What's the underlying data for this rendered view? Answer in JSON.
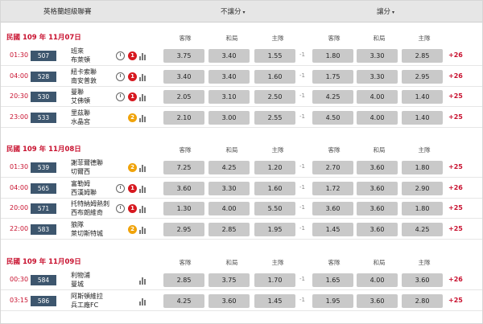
{
  "header": {
    "league": "英格蘭超級聯賽",
    "market_a": "不讓分",
    "market_b": "讓分",
    "caret": "▾"
  },
  "columns": {
    "away": "客隊",
    "draw": "和局",
    "home": "主隊"
  },
  "days": [
    {
      "date": "民國 109 年 11月07日",
      "matches": [
        {
          "time": "01:30",
          "id": "507",
          "team1": "班來",
          "team2": "布萊頓",
          "clock": true,
          "badge": "1",
          "badge_color": "red",
          "o1": "3.75",
          "o2": "3.40",
          "o3": "1.55",
          "hcap": "-1",
          "h1": "1.80",
          "h2": "3.30",
          "h3": "2.85",
          "more": "+26"
        },
        {
          "time": "04:00",
          "id": "528",
          "team1": "紐卡索聯",
          "team2": "南安普敦",
          "clock": true,
          "badge": "1",
          "badge_color": "red",
          "o1": "3.40",
          "o2": "3.40",
          "o3": "1.60",
          "hcap": "-1",
          "h1": "1.75",
          "h2": "3.30",
          "h3": "2.95",
          "more": "+26"
        },
        {
          "time": "20:30",
          "id": "530",
          "team1": "曼聯",
          "team2": "艾佛頓",
          "clock": true,
          "badge": "1",
          "badge_color": "red",
          "o1": "2.05",
          "o2": "3.10",
          "o3": "2.50",
          "hcap": "-1",
          "h1": "4.25",
          "h2": "4.00",
          "h3": "1.40",
          "more": "+25"
        },
        {
          "time": "23:00",
          "id": "533",
          "team1": "里茲聯",
          "team2": "水晶宮",
          "clock": false,
          "badge": "2",
          "badge_color": "orange",
          "o1": "2.10",
          "o2": "3.00",
          "o3": "2.55",
          "hcap": "-1",
          "h1": "4.50",
          "h2": "4.00",
          "h3": "1.40",
          "more": "+25"
        }
      ]
    },
    {
      "date": "民國 109 年 11月08日",
      "matches": [
        {
          "time": "01:30",
          "id": "539",
          "team1": "謝菲爾德聯",
          "team2": "切爾西",
          "clock": false,
          "badge": "2",
          "badge_color": "orange",
          "o1": "7.25",
          "o2": "4.25",
          "o3": "1.20",
          "hcap": "-1",
          "h1": "2.70",
          "h2": "3.60",
          "h3": "1.80",
          "more": "+25"
        },
        {
          "time": "04:00",
          "id": "565",
          "team1": "富勒姆",
          "team2": "西漢姆聯",
          "clock": true,
          "badge": "1",
          "badge_color": "red",
          "o1": "3.60",
          "o2": "3.30",
          "o3": "1.60",
          "hcap": "-1",
          "h1": "1.72",
          "h2": "3.60",
          "h3": "2.90",
          "more": "+26"
        },
        {
          "time": "20:00",
          "id": "571",
          "team1": "托特納姆熱刺",
          "team2": "西布朗維奇",
          "clock": true,
          "badge": "1",
          "badge_color": "red",
          "o1": "1.30",
          "o2": "4.00",
          "o3": "5.50",
          "hcap": "-1",
          "h1": "3.60",
          "h2": "3.60",
          "h3": "1.80",
          "more": "+25"
        },
        {
          "time": "22:00",
          "id": "583",
          "team1": "狼隊",
          "team2": "萊切斯特城",
          "clock": false,
          "badge": "2",
          "badge_color": "orange",
          "o1": "2.95",
          "o2": "2.85",
          "o3": "1.95",
          "hcap": "-1",
          "h1": "1.45",
          "h2": "3.60",
          "h3": "4.25",
          "more": "+25"
        }
      ]
    },
    {
      "date": "民國 109 年 11月09日",
      "matches": [
        {
          "time": "00:30",
          "id": "584",
          "team1": "利物浦",
          "team2": "曼城",
          "clock": false,
          "badge": "",
          "badge_color": "",
          "o1": "2.85",
          "o2": "3.75",
          "o3": "1.70",
          "hcap": "-1",
          "h1": "1.65",
          "h2": "4.00",
          "h3": "3.60",
          "more": "+26"
        },
        {
          "time": "03:15",
          "id": "586",
          "team1": "阿斯頓維拉",
          "team2": "兵工廠FC",
          "clock": false,
          "badge": "",
          "badge_color": "",
          "o1": "4.25",
          "o2": "3.60",
          "o3": "1.45",
          "hcap": "-1",
          "h1": "1.95",
          "h2": "3.60",
          "h3": "2.80",
          "more": "+25"
        }
      ]
    }
  ]
}
